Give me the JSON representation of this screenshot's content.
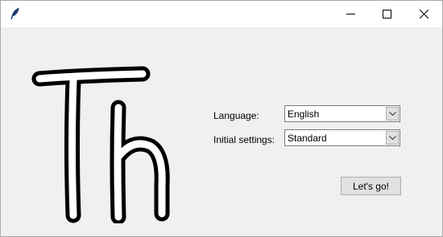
{
  "titlebar": {
    "app_icon": "feather-icon",
    "minimize_icon": "minimize-icon",
    "maximize_icon": "maximize-icon",
    "close_icon": "close-icon"
  },
  "logo": {
    "icon": "th-logo-icon"
  },
  "form": {
    "language_label": "Language:",
    "language_value": "English",
    "settings_label": "Initial settings:",
    "settings_value": "Standard"
  },
  "actions": {
    "go_label": "Let's go!"
  },
  "colors": {
    "window_background": "#f0f0f0",
    "titlebar_background": "#ffffff",
    "button_face": "#e1e1e1"
  }
}
